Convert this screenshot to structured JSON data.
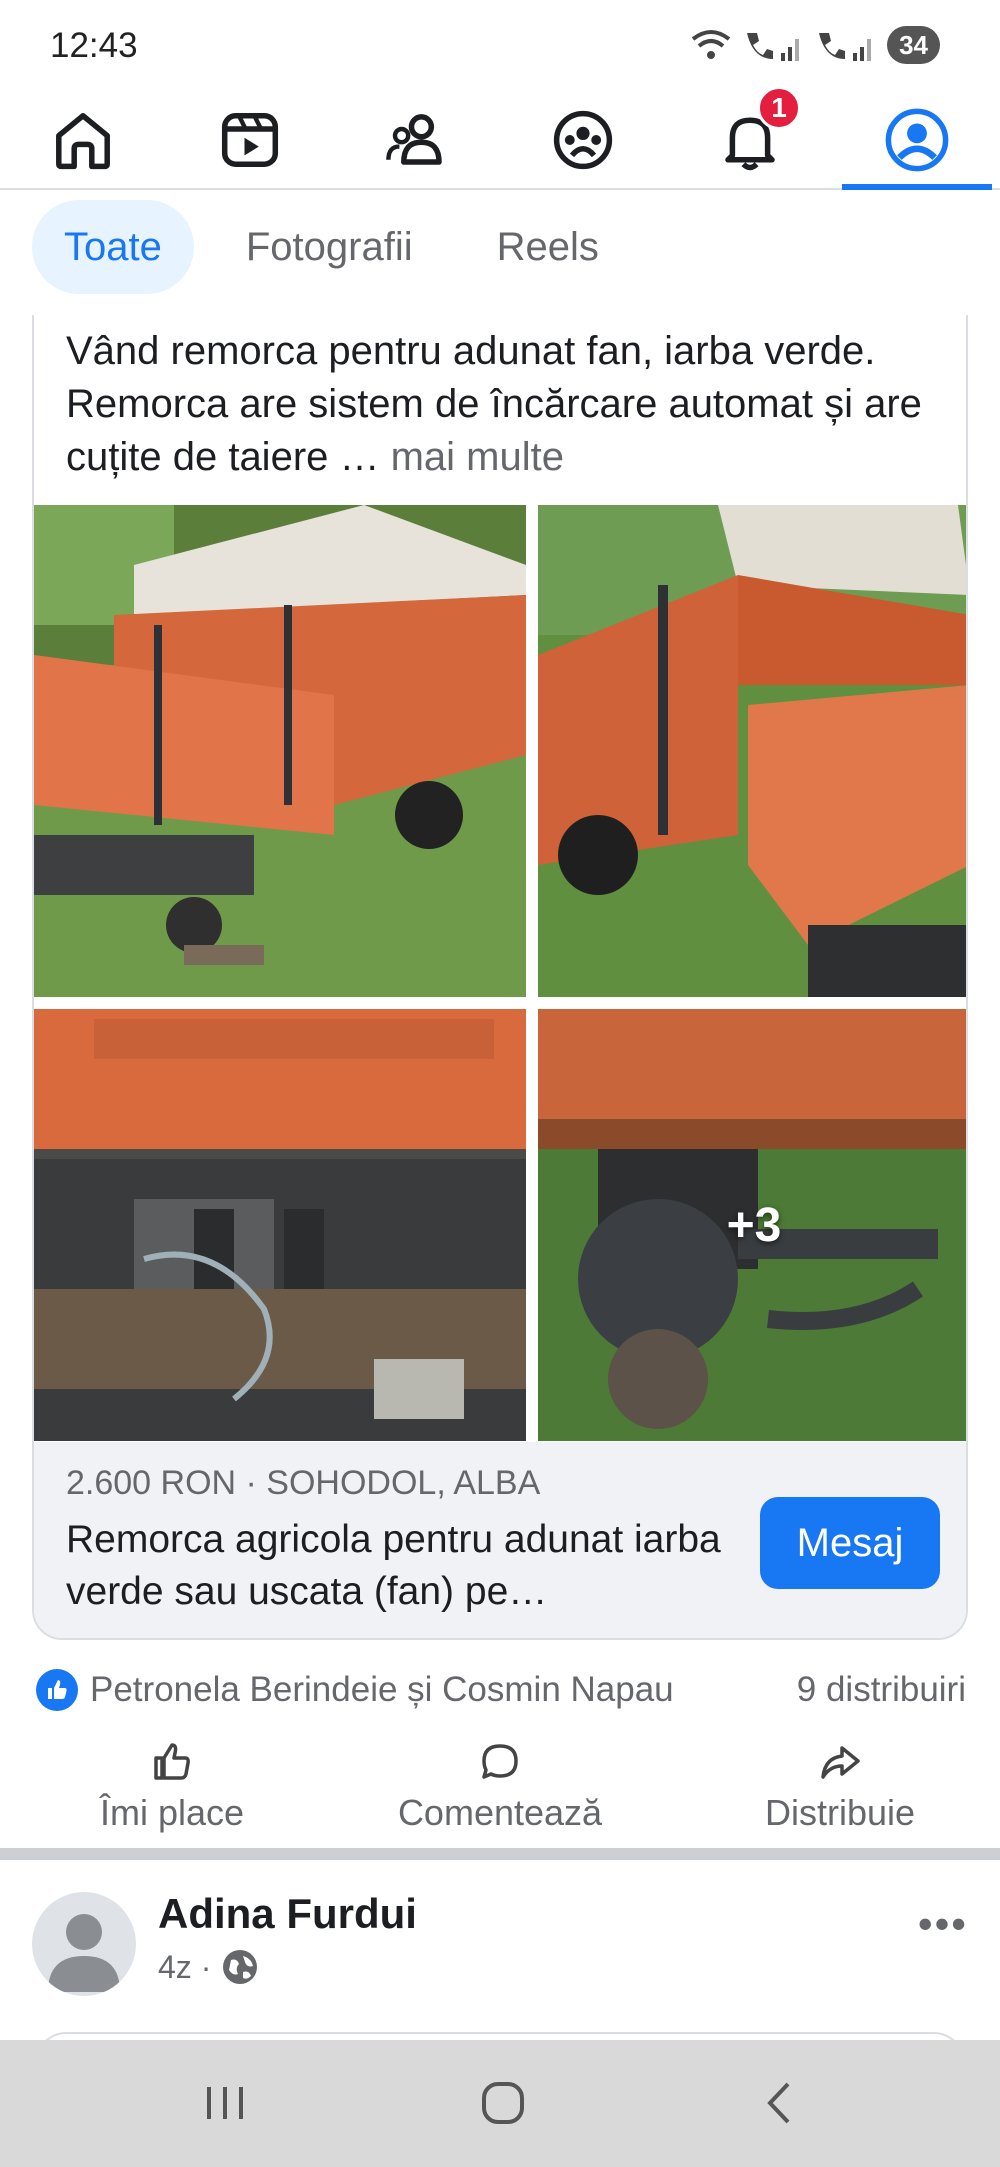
{
  "status_bar": {
    "time": "12:43",
    "battery": "34"
  },
  "top_nav": {
    "items": [
      "home-icon",
      "video-icon",
      "friends-icon",
      "groups-icon",
      "notifications-icon",
      "profile-icon"
    ],
    "notification_count": "1",
    "active": "profile-icon"
  },
  "tabs": [
    {
      "label": "Toate",
      "active": true
    },
    {
      "label": "Fotografii",
      "active": false
    },
    {
      "label": "Reels",
      "active": false
    }
  ],
  "post": {
    "text": "Vând remorca pentru adunat fan, iarba verde. Remorca are sistem de încărcare automat și are cuțite de taiere … ",
    "more_label": "mai multe",
    "more_photos": "+3",
    "listing": {
      "meta": "2.600 RON · SOHODOL, ALBA",
      "title": "Remorca agricola pentru adunat iarba verde sau uscata (fan)  pe…",
      "message_button": "Mesaj"
    },
    "reactors": "Petronela Berindeie și Cosmin Napau",
    "shares": "9 distribuiri",
    "actions": {
      "like": "Îmi place",
      "comment": "Comentează",
      "share": "Distribuie"
    }
  },
  "next_post": {
    "author": "Adina Furdui",
    "time": "4z ·"
  },
  "colors": {
    "accent": "#1877f2",
    "badge": "#e41e3f",
    "trailer_orange": "#d9653a"
  }
}
